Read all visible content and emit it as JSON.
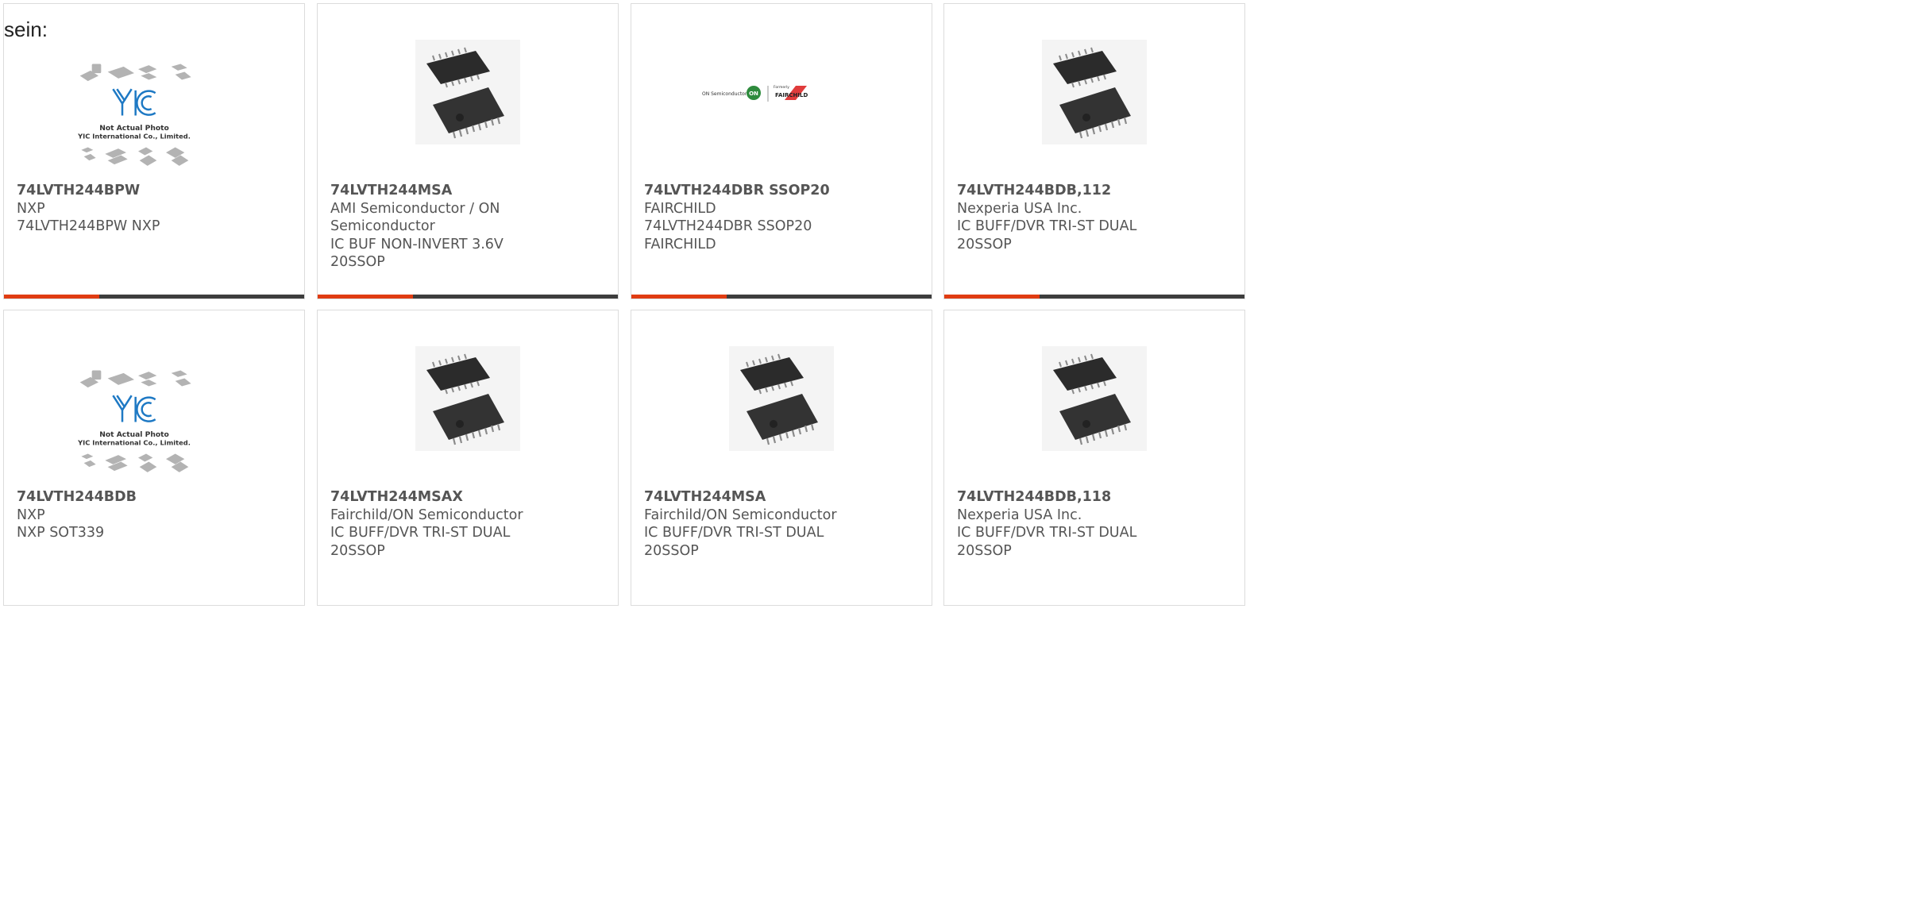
{
  "heading": "sein:",
  "colors": {
    "accent": "#e03c12",
    "bar": "#3d3d3d",
    "text": "#555555",
    "border": "#dcdcdc"
  },
  "products": [
    {
      "part": "74LVTH244BPW",
      "manufacturer": "NXP",
      "description": "74LVTH244BPW NXP",
      "image": "yic-not-actual-photo"
    },
    {
      "part": "74LVTH244MSA",
      "manufacturer": "AMI Semiconductor / ON Semiconductor",
      "description": "IC BUF NON-INVERT 3.6V 20SSOP",
      "image": "ssop-chip-photo"
    },
    {
      "part": "74LVTH244DBR SSOP20",
      "manufacturer": "FAIRCHILD",
      "description": "74LVTH244DBR SSOP20 FAIRCHILD",
      "image": "on-semiconductor-fairchild-logo"
    },
    {
      "part": "74LVTH244BDB,112",
      "manufacturer": "Nexperia USA Inc.",
      "description": "IC BUFF/DVR TRI-ST DUAL 20SSOP",
      "image": "ssop-chip-photo"
    },
    {
      "part": "74LVTH244BDB",
      "manufacturer": "NXP",
      "description": "NXP SOT339",
      "image": "yic-not-actual-photo"
    },
    {
      "part": "74LVTH244MSAX",
      "manufacturer": "Fairchild/ON Semiconductor",
      "description": "IC BUFF/DVR TRI-ST DUAL 20SSOP",
      "image": "ssop-chip-photo"
    },
    {
      "part": "74LVTH244MSA",
      "manufacturer": "Fairchild/ON Semiconductor",
      "description": "IC BUFF/DVR TRI-ST DUAL 20SSOP",
      "image": "ssop-chip-photo"
    },
    {
      "part": "74LVTH244BDB,118",
      "manufacturer": "Nexperia USA Inc.",
      "description": "IC BUFF/DVR TRI-ST DUAL 20SSOP",
      "image": "ssop-chip-photo"
    }
  ],
  "yic": {
    "line1": "Not Actual Photo",
    "line2": "YIC International Co., Limited."
  },
  "logo": {
    "on_semi": "ON Semiconductor",
    "on": "ON",
    "formerly": "Formerly",
    "fairchild": "FAIRCHILD"
  }
}
